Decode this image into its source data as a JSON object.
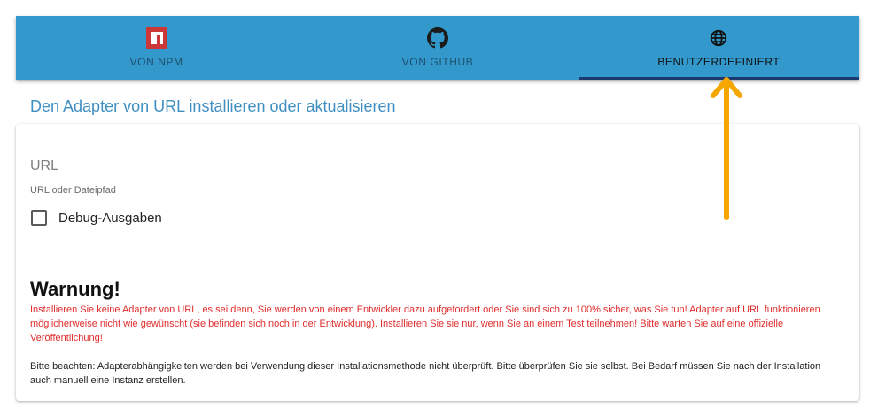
{
  "tabs": [
    {
      "label": "VON NPM",
      "icon": "npm-icon",
      "active": false
    },
    {
      "label": "VON GITHUB",
      "icon": "github-icon",
      "active": false
    },
    {
      "label": "BENUTZERDEFINIERT",
      "icon": "globe-icon",
      "active": true
    }
  ],
  "section_title": "Den Adapter von URL installieren oder aktualisieren",
  "url_field": {
    "placeholder": "URL",
    "value": "",
    "helper": "URL oder Dateipfad"
  },
  "debug_checkbox": {
    "label": "Debug-Ausgaben",
    "checked": false
  },
  "warning": {
    "title": "Warnung!",
    "text": "Installieren Sie keine Adapter von URL, es sei denn, Sie werden von einem Entwickler dazu aufgefordert oder Sie sind sich zu 100% sicher, was Sie tun! Adapter auf URL funktionieren möglicherweise nicht wie gewünscht (sie befinden sich noch in der Entwicklung). Installieren Sie sie nur, wenn Sie an einem Test teilnehmen! Bitte warten Sie auf eine offizielle Veröffentlichung!",
    "note": "Bitte beachten: Adapterabhängigkeiten werden bei Verwendung dieser Installationsmethode nicht überprüft. Bitte überprüfen Sie sie selbst. Bei Bedarf müssen Sie nach der Installation auch manuell eine Instanz erstellen."
  },
  "colors": {
    "tabbar": "#3399cc",
    "active_indicator": "#1c3a6e",
    "warning_text": "#e02c2c",
    "arrow": "#f5a700",
    "title": "#3f8fc2"
  }
}
